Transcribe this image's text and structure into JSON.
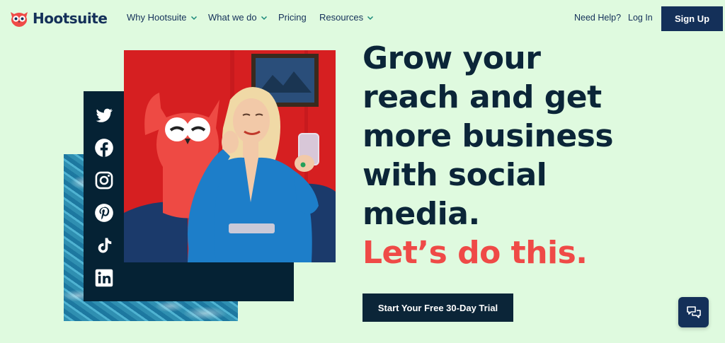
{
  "header": {
    "logo_text": "Hootsuite",
    "nav": [
      {
        "label": "Why Hootsuite",
        "icon": "chevron-down-icon"
      },
      {
        "label": "What we do",
        "icon": "chevron-down-icon"
      },
      {
        "label": "Pricing"
      },
      {
        "label": "Resources",
        "icon": "chevron-down-icon"
      }
    ],
    "need_help": "Need Help?",
    "login": "Log In",
    "signup": "Sign Up"
  },
  "hero": {
    "headline_lines": [
      "Grow your",
      "reach and get",
      "more business",
      "with social",
      "media."
    ],
    "headline_accent": "Let’s do this.",
    "cta": "Start Your Free 30-Day Trial",
    "social_icons": [
      "twitter-icon",
      "facebook-icon",
      "instagram-icon",
      "pinterest-icon",
      "tiktok-icon",
      "linkedin-icon"
    ]
  },
  "colors": {
    "background": "#dffadf",
    "navy": "#143059",
    "dark": "#0b2538",
    "accent": "#ef4a47",
    "photo_red": "#d8201f"
  },
  "chat": {
    "icon": "chat-icon"
  }
}
